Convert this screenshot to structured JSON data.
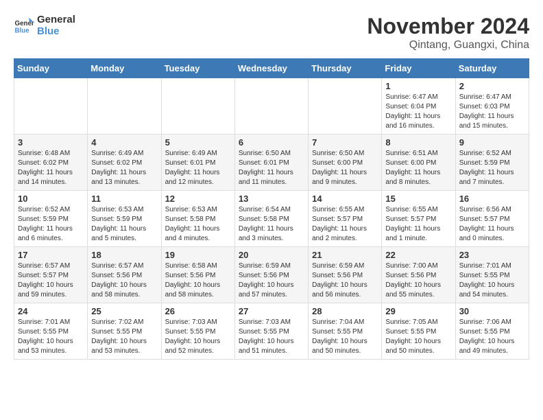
{
  "header": {
    "logo_line1": "General",
    "logo_line2": "Blue",
    "month_year": "November 2024",
    "location": "Qintang, Guangxi, China"
  },
  "weekdays": [
    "Sunday",
    "Monday",
    "Tuesday",
    "Wednesday",
    "Thursday",
    "Friday",
    "Saturday"
  ],
  "weeks": [
    [
      {
        "day": "",
        "info": ""
      },
      {
        "day": "",
        "info": ""
      },
      {
        "day": "",
        "info": ""
      },
      {
        "day": "",
        "info": ""
      },
      {
        "day": "",
        "info": ""
      },
      {
        "day": "1",
        "info": "Sunrise: 6:47 AM\nSunset: 6:04 PM\nDaylight: 11 hours and 16 minutes."
      },
      {
        "day": "2",
        "info": "Sunrise: 6:47 AM\nSunset: 6:03 PM\nDaylight: 11 hours and 15 minutes."
      }
    ],
    [
      {
        "day": "3",
        "info": "Sunrise: 6:48 AM\nSunset: 6:02 PM\nDaylight: 11 hours and 14 minutes."
      },
      {
        "day": "4",
        "info": "Sunrise: 6:49 AM\nSunset: 6:02 PM\nDaylight: 11 hours and 13 minutes."
      },
      {
        "day": "5",
        "info": "Sunrise: 6:49 AM\nSunset: 6:01 PM\nDaylight: 11 hours and 12 minutes."
      },
      {
        "day": "6",
        "info": "Sunrise: 6:50 AM\nSunset: 6:01 PM\nDaylight: 11 hours and 11 minutes."
      },
      {
        "day": "7",
        "info": "Sunrise: 6:50 AM\nSunset: 6:00 PM\nDaylight: 11 hours and 9 minutes."
      },
      {
        "day": "8",
        "info": "Sunrise: 6:51 AM\nSunset: 6:00 PM\nDaylight: 11 hours and 8 minutes."
      },
      {
        "day": "9",
        "info": "Sunrise: 6:52 AM\nSunset: 5:59 PM\nDaylight: 11 hours and 7 minutes."
      }
    ],
    [
      {
        "day": "10",
        "info": "Sunrise: 6:52 AM\nSunset: 5:59 PM\nDaylight: 11 hours and 6 minutes."
      },
      {
        "day": "11",
        "info": "Sunrise: 6:53 AM\nSunset: 5:59 PM\nDaylight: 11 hours and 5 minutes."
      },
      {
        "day": "12",
        "info": "Sunrise: 6:53 AM\nSunset: 5:58 PM\nDaylight: 11 hours and 4 minutes."
      },
      {
        "day": "13",
        "info": "Sunrise: 6:54 AM\nSunset: 5:58 PM\nDaylight: 11 hours and 3 minutes."
      },
      {
        "day": "14",
        "info": "Sunrise: 6:55 AM\nSunset: 5:57 PM\nDaylight: 11 hours and 2 minutes."
      },
      {
        "day": "15",
        "info": "Sunrise: 6:55 AM\nSunset: 5:57 PM\nDaylight: 11 hours and 1 minute."
      },
      {
        "day": "16",
        "info": "Sunrise: 6:56 AM\nSunset: 5:57 PM\nDaylight: 11 hours and 0 minutes."
      }
    ],
    [
      {
        "day": "17",
        "info": "Sunrise: 6:57 AM\nSunset: 5:57 PM\nDaylight: 10 hours and 59 minutes."
      },
      {
        "day": "18",
        "info": "Sunrise: 6:57 AM\nSunset: 5:56 PM\nDaylight: 10 hours and 58 minutes."
      },
      {
        "day": "19",
        "info": "Sunrise: 6:58 AM\nSunset: 5:56 PM\nDaylight: 10 hours and 58 minutes."
      },
      {
        "day": "20",
        "info": "Sunrise: 6:59 AM\nSunset: 5:56 PM\nDaylight: 10 hours and 57 minutes."
      },
      {
        "day": "21",
        "info": "Sunrise: 6:59 AM\nSunset: 5:56 PM\nDaylight: 10 hours and 56 minutes."
      },
      {
        "day": "22",
        "info": "Sunrise: 7:00 AM\nSunset: 5:56 PM\nDaylight: 10 hours and 55 minutes."
      },
      {
        "day": "23",
        "info": "Sunrise: 7:01 AM\nSunset: 5:55 PM\nDaylight: 10 hours and 54 minutes."
      }
    ],
    [
      {
        "day": "24",
        "info": "Sunrise: 7:01 AM\nSunset: 5:55 PM\nDaylight: 10 hours and 53 minutes."
      },
      {
        "day": "25",
        "info": "Sunrise: 7:02 AM\nSunset: 5:55 PM\nDaylight: 10 hours and 53 minutes."
      },
      {
        "day": "26",
        "info": "Sunrise: 7:03 AM\nSunset: 5:55 PM\nDaylight: 10 hours and 52 minutes."
      },
      {
        "day": "27",
        "info": "Sunrise: 7:03 AM\nSunset: 5:55 PM\nDaylight: 10 hours and 51 minutes."
      },
      {
        "day": "28",
        "info": "Sunrise: 7:04 AM\nSunset: 5:55 PM\nDaylight: 10 hours and 50 minutes."
      },
      {
        "day": "29",
        "info": "Sunrise: 7:05 AM\nSunset: 5:55 PM\nDaylight: 10 hours and 50 minutes."
      },
      {
        "day": "30",
        "info": "Sunrise: 7:06 AM\nSunset: 5:55 PM\nDaylight: 10 hours and 49 minutes."
      }
    ]
  ]
}
